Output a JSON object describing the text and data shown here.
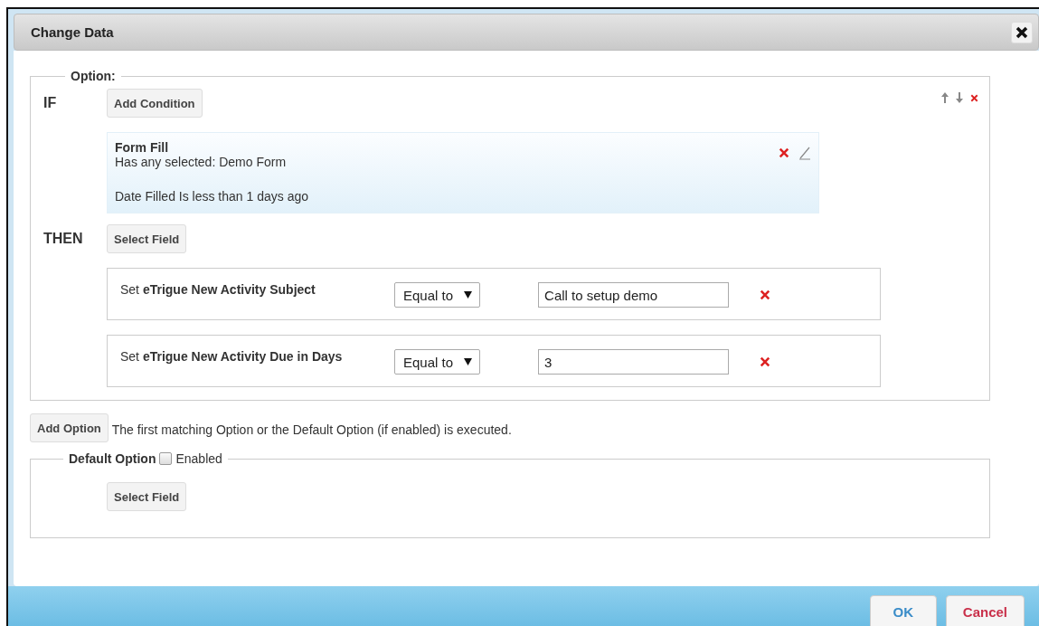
{
  "dialog": {
    "title": "Change Data"
  },
  "option": {
    "legend": "Option:",
    "if_label": "IF",
    "add_condition_button": "Add Condition",
    "conditions": [
      {
        "title": "Form Fill",
        "lines": [
          "Has any selected: Demo Form",
          "Date Filled Is less than 1 days ago"
        ]
      }
    ],
    "then_label": "THEN",
    "select_field_button": "Select Field",
    "actions": [
      {
        "label": "Set **eTrigue New Activity Subject**",
        "operator": "Equal to",
        "value": "Call to setup demo"
      },
      {
        "label": "Set **eTrigue New Activity Due in Days**",
        "operator": "Equal to",
        "value": "3"
      }
    ]
  },
  "add_option_button": "Add Option",
  "hint": "The first matching Option or the Default Option (if enabled) is executed.",
  "default_option": {
    "legend": "Default Option",
    "enabled_label": "Enabled",
    "enabled": false,
    "select_field_button": "Select Field"
  },
  "buttons": [
    {
      "label": "OK",
      "kind": "primary"
    },
    {
      "label": "Cancel",
      "kind": "cancel"
    }
  ]
}
